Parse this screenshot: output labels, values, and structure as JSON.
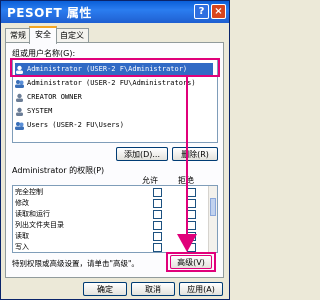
{
  "window": {
    "title": "PESOFT 属性",
    "help_label": "?",
    "close_label": "×"
  },
  "tabs": [
    {
      "label": "常规"
    },
    {
      "label": "安全"
    },
    {
      "label": "自定义"
    }
  ],
  "users_section": {
    "label": "组或用户名称(G):",
    "items": [
      {
        "name": "Administrator (USER-2      F\\Administrator)"
      },
      {
        "name": "Administrator (USER-2      FU\\Administrators)"
      },
      {
        "name": "CREATOR OWNER"
      },
      {
        "name": "SYSTEM"
      },
      {
        "name": "Users (USER-2      FU\\Users)"
      }
    ],
    "add_button": "添加(D)...",
    "remove_button": "删除(R)"
  },
  "permissions_section": {
    "label": "Administrator 的权限(P)",
    "col_allow": "允许",
    "col_deny": "拒绝",
    "rows": [
      {
        "name": "完全控制"
      },
      {
        "name": "修改"
      },
      {
        "name": "读取和运行"
      },
      {
        "name": "列出文件夹目录"
      },
      {
        "name": "读取"
      },
      {
        "name": "写入"
      }
    ]
  },
  "advanced_note": "特别权限或高级设置，请单击\"高级\"。",
  "advanced_button": "高级(V)",
  "footer": {
    "ok": "确定",
    "cancel": "取消",
    "apply": "应用(A)"
  },
  "colors": {
    "highlight": "#e0007a",
    "selection": "#316ac5"
  }
}
